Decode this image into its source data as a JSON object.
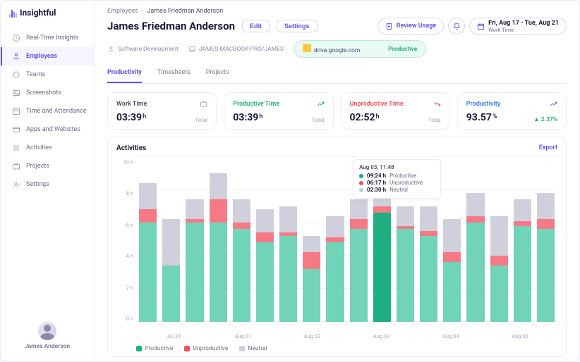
{
  "brand": "Insightful",
  "nav": [
    {
      "label": "Real-Time Insights",
      "icon": "clock"
    },
    {
      "label": "Employees",
      "icon": "user",
      "active": true
    },
    {
      "label": "Teams",
      "icon": "circle"
    },
    {
      "label": "Screenshots",
      "icon": "image"
    },
    {
      "label": "Time and Attendance",
      "icon": "calendar"
    },
    {
      "label": "Apps and Websites",
      "icon": "window"
    },
    {
      "label": "Activities",
      "icon": "list"
    },
    {
      "label": "Projects",
      "icon": "briefcase"
    },
    {
      "label": "Settings",
      "icon": "gear"
    }
  ],
  "sidebar_user": "James Anderson",
  "breadcrumb": {
    "parent": "Employees",
    "current": "James Friedman Anderson"
  },
  "page_title": "James Friedman Anderson",
  "buttons": {
    "edit": "Edit",
    "settings": "Settings"
  },
  "toolbar": {
    "review": "Review Usage",
    "date_main": "Fri, Aug 17 - Tue, Aug 21",
    "date_sub": "Work Time"
  },
  "meta": {
    "team": "Software Development",
    "device": "JAMES-MACBOOK-PRO/JAMES"
  },
  "activity_badge": {
    "app": "drive.google.com",
    "status": "Productive"
  },
  "tabs": [
    {
      "label": "Productivity",
      "active": true
    },
    {
      "label": "Timesheets"
    },
    {
      "label": "Projects"
    }
  ],
  "stats": [
    {
      "label": "Work Time",
      "value": "03:39",
      "unit": "h",
      "sub": "Total",
      "cls": "c-work",
      "icon": "briefcase"
    },
    {
      "label": "Productive Time",
      "value": "03:39",
      "unit": "h",
      "sub": "Total",
      "cls": "c-prod",
      "icon": "trend-up"
    },
    {
      "label": "Unproductive Time",
      "value": "02:52",
      "unit": "h",
      "sub": "Total",
      "cls": "c-unprod",
      "icon": "trend-down"
    },
    {
      "label": "Productivity",
      "value": "93.57",
      "unit": "%",
      "trend": "▲ 2.37%",
      "cls": "c-prodv",
      "icon": "trend-up"
    }
  ],
  "activities": {
    "title": "Activities",
    "export": "Export"
  },
  "tooltip": {
    "date": "Aug 03, 11:48",
    "rows": [
      {
        "kind": "p",
        "val": "09:24 h",
        "label": "Productive"
      },
      {
        "kind": "u",
        "val": "06:17 h",
        "label": "Unproductive"
      },
      {
        "kind": "n",
        "val": "02:30 h",
        "label": "Neutral"
      }
    ]
  },
  "legend": [
    {
      "kind": "p",
      "label": "Productive"
    },
    {
      "kind": "u",
      "label": "Unproductive"
    },
    {
      "kind": "n",
      "label": "Neutral"
    }
  ],
  "chart_data": {
    "type": "bar",
    "title": "Activities",
    "ylabel": "hours",
    "ylim": [
      0,
      10
    ],
    "y_ticks": [
      "10 h",
      "8 h",
      "6 h",
      "4 h",
      "2 h",
      "0 h"
    ],
    "x_groups": [
      "Jul 31",
      "Aug 01",
      "Aug 02",
      "Aug 03",
      "Aug 04",
      "Aug 05"
    ],
    "series_names": [
      "Productive",
      "Unproductive",
      "Neutral"
    ],
    "bars": [
      {
        "p": 6.0,
        "u": 0.8,
        "n": 1.6
      },
      {
        "p": 3.4,
        "u": 0.0,
        "n": 2.8
      },
      {
        "p": 6.0,
        "u": 0.2,
        "n": 1.2
      },
      {
        "p": 6.0,
        "u": 1.4,
        "n": 1.6
      },
      {
        "p": 5.6,
        "u": 0.4,
        "n": 1.4
      },
      {
        "p": 4.8,
        "u": 0.6,
        "n": 1.4
      },
      {
        "p": 5.2,
        "u": 0.2,
        "n": 1.6
      },
      {
        "p": 3.2,
        "u": 1.0,
        "n": 1.0
      },
      {
        "p": 4.8,
        "u": 0.3,
        "n": 1.3
      },
      {
        "p": 5.6,
        "u": 0.6,
        "n": 1.2
      },
      {
        "p": 6.6,
        "u": 0.4,
        "n": 2.2,
        "hl": true
      },
      {
        "p": 5.6,
        "u": 0.2,
        "n": 1.2
      },
      {
        "p": 5.2,
        "u": 0.3,
        "n": 1.5
      },
      {
        "p": 3.6,
        "u": 0.6,
        "n": 2.0
      },
      {
        "p": 6.0,
        "u": 0.4,
        "n": 1.4
      },
      {
        "p": 3.4,
        "u": 0.6,
        "n": 2.4
      },
      {
        "p": 5.8,
        "u": 0.3,
        "n": 1.3
      },
      {
        "p": 5.6,
        "u": 0.6,
        "n": 1.6
      }
    ]
  }
}
